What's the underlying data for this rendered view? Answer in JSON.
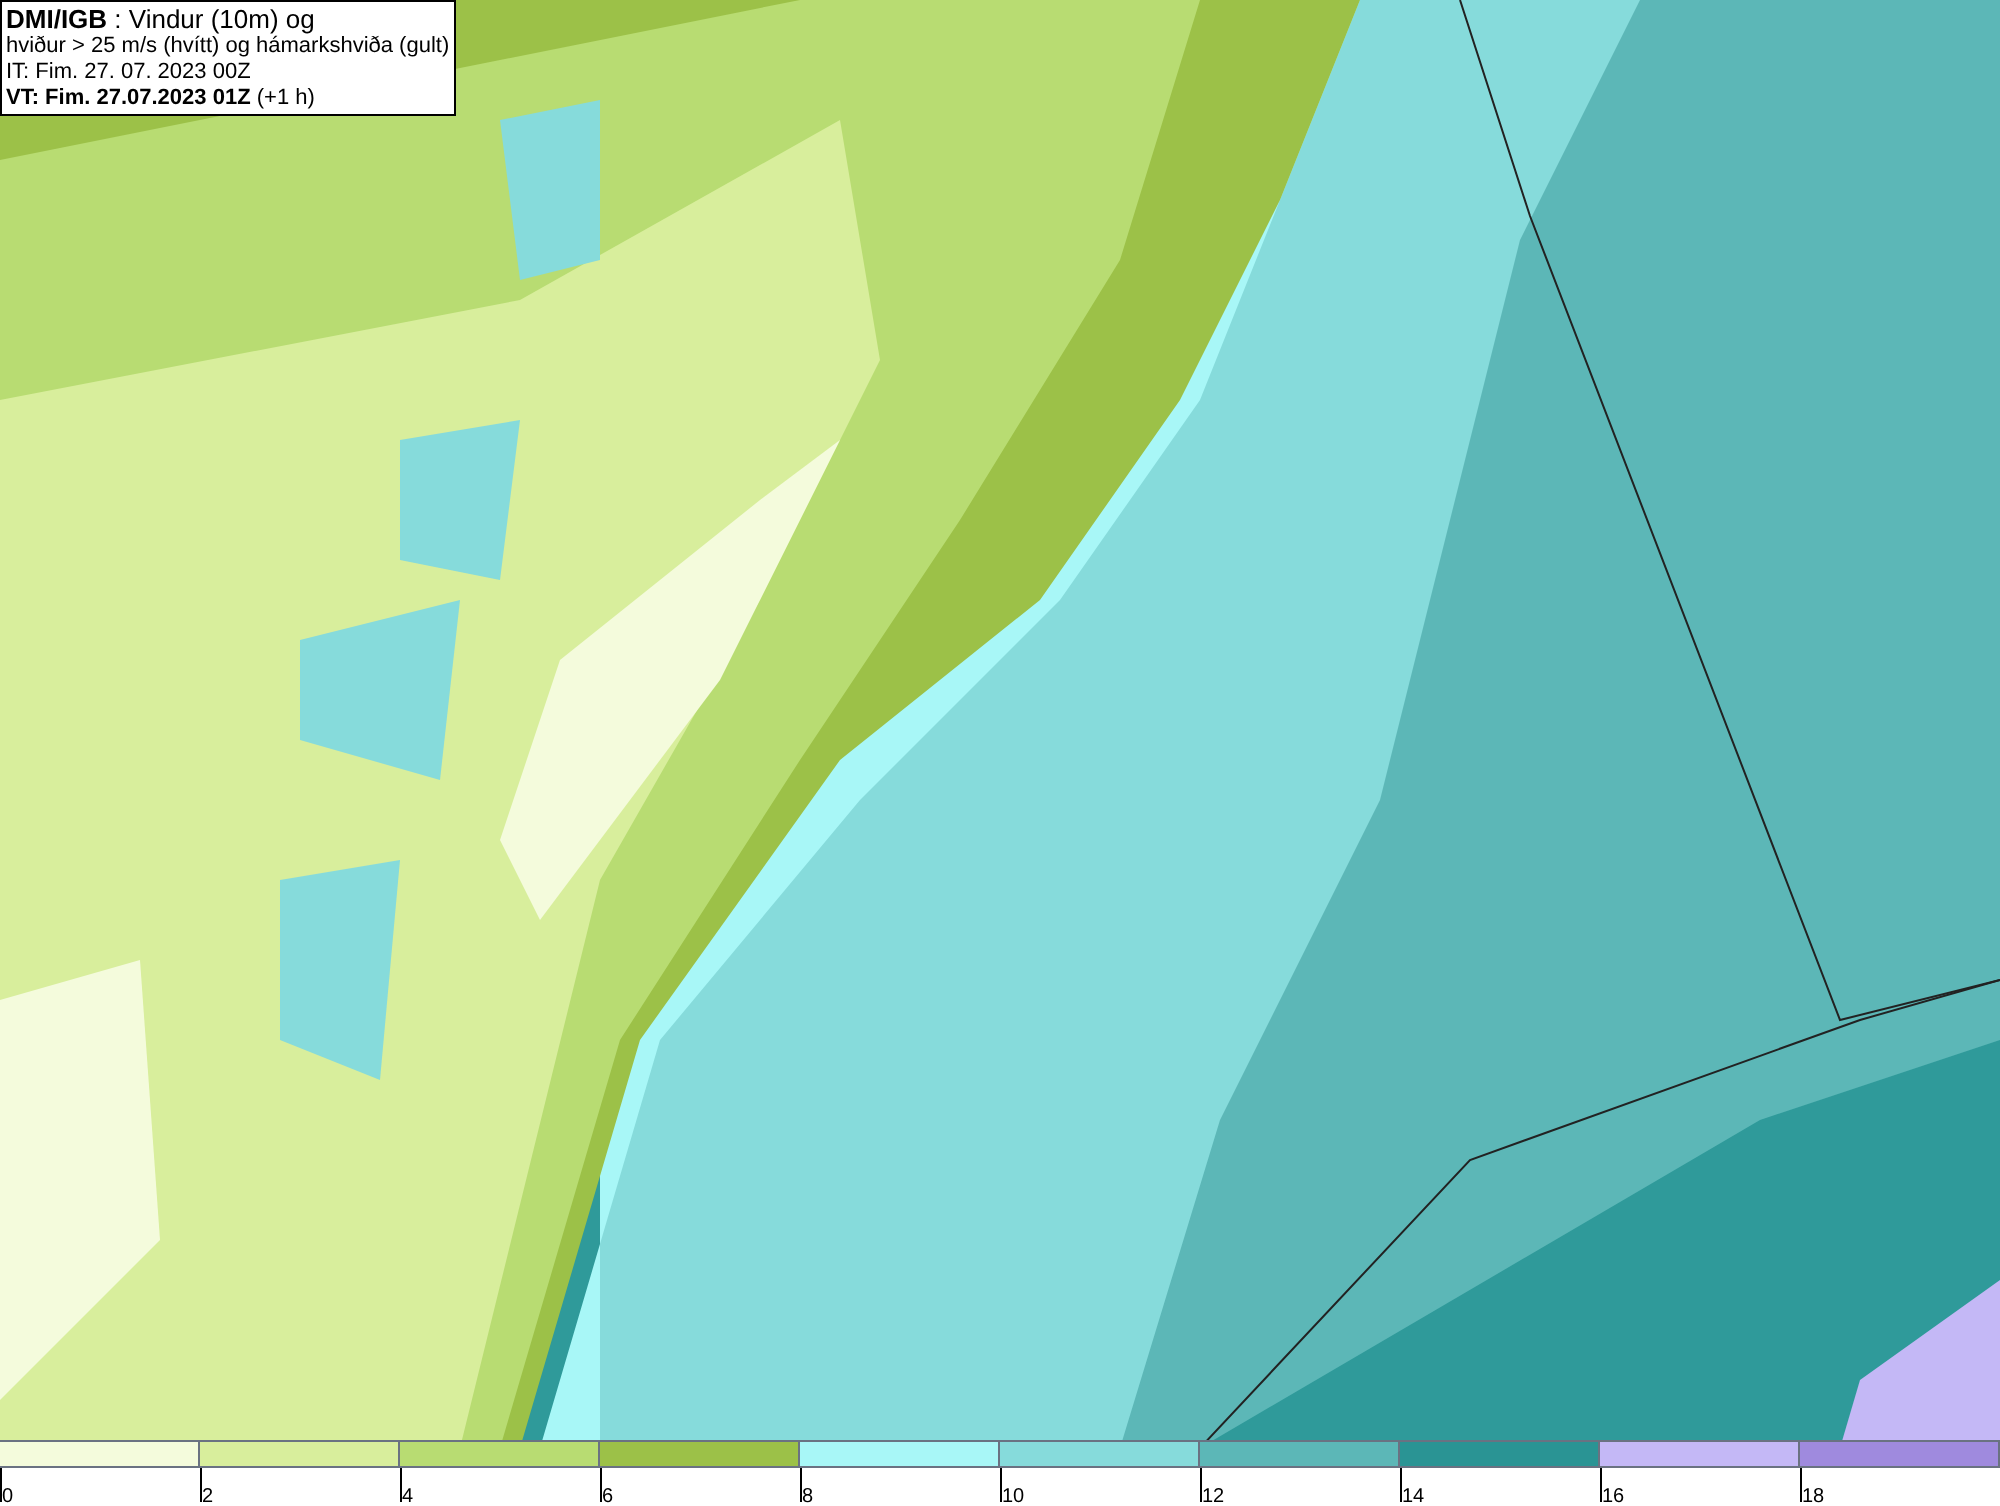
{
  "header": {
    "lines": [
      "**DMI/IGB** : Vindur (10m) og",
      "hviður > 25 m/s (hvítt) og hámarkshviða (gult)",
      "IT: Fim. 27. 07. 2023 00Z",
      "**VT: Fim. 27.07.2023 01Z** (+1 h)"
    ]
  },
  "legend": [
    {
      "label": "0",
      "color": "#f4fbdc"
    },
    {
      "label": "2",
      "color": "#d8ee9c"
    },
    {
      "label": "4",
      "color": "#b8dc72"
    },
    {
      "label": "6",
      "color": "#9cc148"
    },
    {
      "label": "8",
      "color": "#a8f7f7"
    },
    {
      "label": "10",
      "color": "#86dbdb"
    },
    {
      "label": "12",
      "color": "#5cb7b7"
    },
    {
      "label": "14",
      "color": "#2a9494"
    },
    {
      "label": "16",
      "color": "#c4b8f6"
    },
    {
      "label": "18",
      "color": "#9f8ade"
    }
  ]
}
